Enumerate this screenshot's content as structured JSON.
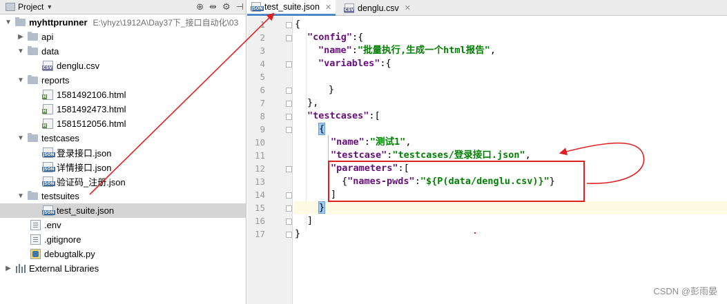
{
  "project_panel": {
    "title": "Project",
    "tree": [
      {
        "label": "myhttprunner",
        "path": "E:\\yhyz\\1912A\\Day37下_接口自动化\\03"
      },
      {
        "label": "api"
      },
      {
        "label": "data"
      },
      {
        "label": "denglu.csv"
      },
      {
        "label": "reports"
      },
      {
        "label": "1581492106.html"
      },
      {
        "label": "1581492473.html"
      },
      {
        "label": "1581512056.html"
      },
      {
        "label": "testcases"
      },
      {
        "label": "登录接口.json"
      },
      {
        "label": "详情接口.json"
      },
      {
        "label": "验证码_注册.json"
      },
      {
        "label": "testsuites"
      },
      {
        "label": "test_suite.json"
      },
      {
        "label": ".env"
      },
      {
        "label": ".gitignore"
      },
      {
        "label": "debugtalk.py"
      },
      {
        "label": "External Libraries"
      }
    ]
  },
  "editor": {
    "tabs": [
      {
        "label": "test_suite.json"
      },
      {
        "label": "denglu.csv"
      }
    ],
    "line_numbers": [
      "1",
      "2",
      "3",
      "4",
      "5",
      "6",
      "7",
      "8",
      "9",
      "10",
      "11",
      "12",
      "13",
      "14",
      "15",
      "16",
      "17"
    ],
    "code": {
      "l1_brace": "{",
      "l2_key": "\"config\"",
      "l2_rest": ":{",
      "l3_key": "\"name\"",
      "l3_colon": ":",
      "l3_val": "\"批量执行,生成一个html报告\"",
      "l3_comma": ",",
      "l4_key": "\"variables\"",
      "l4_rest": ":{",
      "l6": "}",
      "l7": "},",
      "l8_key": "\"testcases\"",
      "l8_rest": ":[",
      "l9": "{",
      "l10_key": "\"name\"",
      "l10_colon": ":",
      "l10_val": "\"测试1\"",
      "l10_comma": ",",
      "l11_key": "\"testcase\"",
      "l11_colon": ":",
      "l11_val": "\"testcases/登录接口.json\"",
      "l11_comma": ",",
      "l12_key": "\"parameters\"",
      "l12_rest": ":[",
      "l13_open": "{",
      "l13_key": "\"names-pwds\"",
      "l13_colon": ":",
      "l13_val": "\"${P(data/denglu.csv)}\"",
      "l13_close": "}",
      "l14": "]",
      "l15": "}",
      "l16": "]",
      "l17": "}"
    }
  },
  "watermark": "CSDN @彭雨晏",
  "colors": {
    "keyword": "#660e7a",
    "string": "#008000",
    "annotation": "#e02020",
    "selection": "#d5d5d5",
    "tab_accent": "#4a88c7"
  }
}
